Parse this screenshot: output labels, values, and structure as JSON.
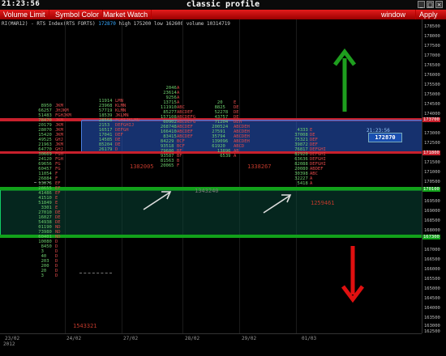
{
  "clock": "21:23:56",
  "window_title": "classic profile",
  "window_buttons": [
    "_",
    "□",
    "×"
  ],
  "menu": [
    "Volume Limit",
    "Symbol Color",
    "Market Watch"
  ],
  "menu_right": [
    "window",
    "Apply"
  ],
  "instrument": {
    "symbol": "RI(MAR12) - RTS Index(RTS FORTS)",
    "last": "172870",
    "high_label": "high",
    "high": "175200",
    "low_label": "low",
    "low": "162600",
    "volume_label": "volume",
    "volume": "10314719"
  },
  "last_badge": {
    "time": "21:23:56",
    "price": "172870"
  },
  "profile_volumes": [
    {
      "v": "1382005"
    },
    {
      "v": "1338267"
    },
    {
      "v": "1343240"
    },
    {
      "v": "1259461"
    },
    {
      "v": "1543321"
    }
  ],
  "price_scale": [
    "178500",
    "178000",
    "177500",
    "177000",
    "176500",
    "176000",
    "175500",
    "175000",
    "174500",
    "174000",
    "173500",
    "173000",
    "172500",
    "172000",
    "171500",
    "171000",
    "170500",
    "170000",
    "169500",
    "169000",
    "168500",
    "168000",
    "167500",
    "167000",
    "166500",
    "166000",
    "165500",
    "165000",
    "164500",
    "164000",
    "163500",
    "163000",
    "162500"
  ],
  "scale_highlights": {
    "red1": "173700",
    "red2": "171800",
    "green1": "170100",
    "green2": "167300"
  },
  "dates": [
    "23/02",
    "24/02",
    "27/02",
    "28/02",
    "29/02",
    "01/03"
  ],
  "year": "2012",
  "colors": {
    "menu_red": "#c8202c",
    "va_blue": "#285ac8",
    "green_band": "#12a11a",
    "up_arrow": "#1e9e1e",
    "down_arrow": "#e01010"
  }
}
